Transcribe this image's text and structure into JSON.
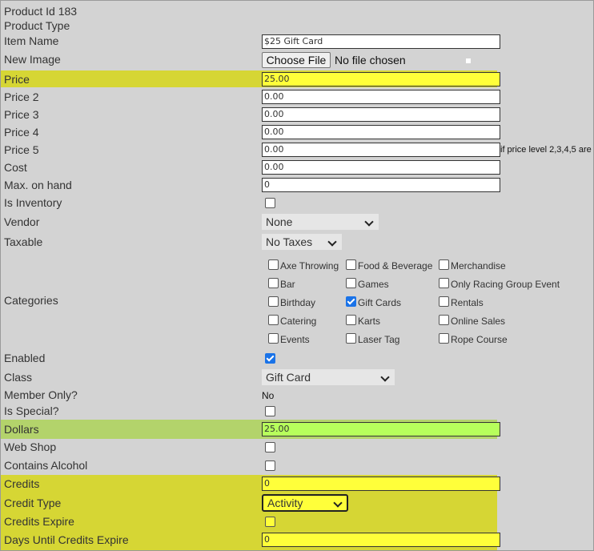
{
  "product_id": "Product Id 183",
  "product_type_label": "Product Type",
  "item_name": {
    "label": "Item Name",
    "value": "$25 Gift Card"
  },
  "new_image": {
    "label": "New Image",
    "button": "Choose File",
    "status": "No file chosen"
  },
  "price": {
    "label": "Price",
    "value": "25.00"
  },
  "price2": {
    "label": "Price 2",
    "value": "0.00"
  },
  "price3": {
    "label": "Price 3",
    "value": "0.00"
  },
  "price4": {
    "label": "Price 4",
    "value": "0.00"
  },
  "price5": {
    "label": "Price 5",
    "value": "0.00",
    "note": "if price level 2,3,4,5 are"
  },
  "cost": {
    "label": "Cost",
    "value": "0.00"
  },
  "max_on_hand": {
    "label": "Max. on hand",
    "value": "0"
  },
  "is_inventory": {
    "label": "Is Inventory",
    "checked": false
  },
  "vendor": {
    "label": "Vendor",
    "selected": "None"
  },
  "taxable": {
    "label": "Taxable",
    "selected": "No Taxes"
  },
  "categories": {
    "label": "Categories",
    "col1": [
      {
        "name": "Axe Throwing",
        "checked": false
      },
      {
        "name": "Bar",
        "checked": false
      },
      {
        "name": "Birthday",
        "checked": false
      },
      {
        "name": "Catering",
        "checked": false
      },
      {
        "name": "Events",
        "checked": false
      }
    ],
    "col2": [
      {
        "name": "Food & Beverage",
        "checked": false
      },
      {
        "name": "Games",
        "checked": false
      },
      {
        "name": "Gift Cards",
        "checked": true
      },
      {
        "name": "Karts",
        "checked": false
      },
      {
        "name": "Laser Tag",
        "checked": false
      }
    ],
    "col3": [
      {
        "name": "Merchandise",
        "checked": false
      },
      {
        "name": "Only Racing Group Event",
        "checked": false
      },
      {
        "name": "Rentals",
        "checked": false
      },
      {
        "name": "Online Sales",
        "checked": false
      },
      {
        "name": "Rope Course",
        "checked": false
      }
    ]
  },
  "enabled": {
    "label": "Enabled",
    "checked": true
  },
  "class": {
    "label": "Class",
    "selected": "Gift Card"
  },
  "member_only": {
    "label": "Member Only?",
    "value": "No"
  },
  "is_special": {
    "label": "Is Special?",
    "checked": false
  },
  "dollars": {
    "label": "Dollars",
    "value": "25.00"
  },
  "web_shop": {
    "label": "Web Shop",
    "checked": false
  },
  "contains_alcohol": {
    "label": "Contains Alcohol",
    "checked": false
  },
  "credits": {
    "label": "Credits",
    "value": "0"
  },
  "credit_type": {
    "label": "Credit Type",
    "selected": "Activity"
  },
  "credits_expire": {
    "label": "Credits Expire",
    "checked": false
  },
  "days_until_expire": {
    "label": "Days Until Credits Expire",
    "value": "0"
  },
  "colors": {
    "highlight_yellow": "#d6d634",
    "highlight_green": "#b3d36b",
    "input_yellow": "#ffff3a",
    "input_green": "#b7ff5c",
    "checkbox_checked": "#1a73e8"
  }
}
